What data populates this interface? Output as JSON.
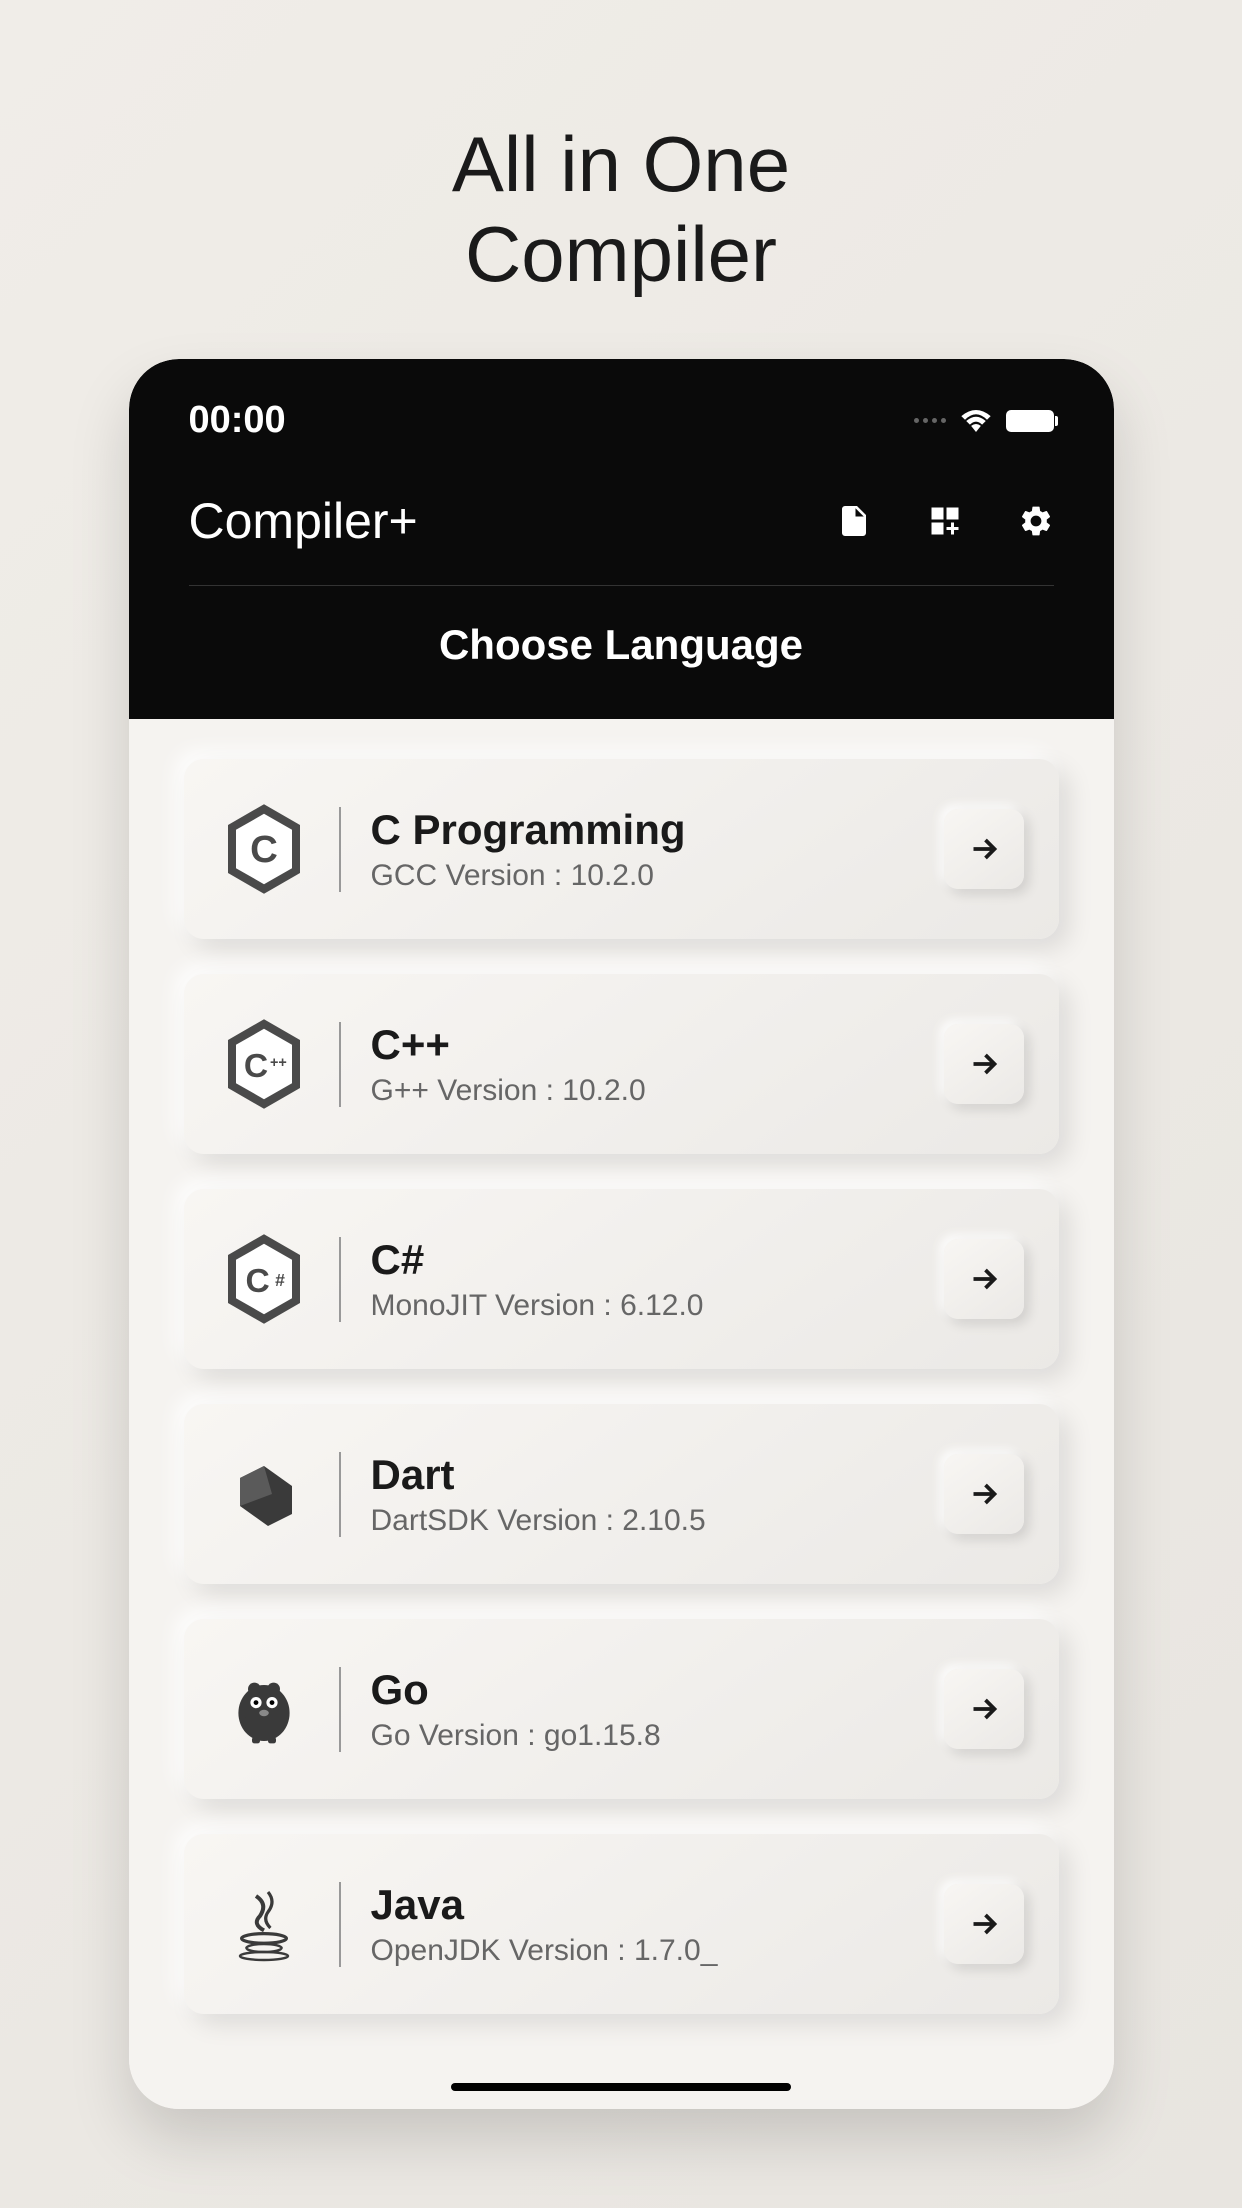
{
  "page": {
    "title_line1": "All in One",
    "title_line2": "Compiler"
  },
  "statusBar": {
    "time": "00:00"
  },
  "appBar": {
    "title": "Compiler+",
    "sectionTitle": "Choose Language"
  },
  "languages": [
    {
      "name": "C Programming",
      "version": "GCC Version : 10.2.0",
      "icon": "c-icon"
    },
    {
      "name": "C++",
      "version": "G++ Version : 10.2.0",
      "icon": "cpp-icon"
    },
    {
      "name": "C#",
      "version": "MonoJIT Version : 6.12.0",
      "icon": "csharp-icon"
    },
    {
      "name": "Dart",
      "version": "DartSDK Version : 2.10.5",
      "icon": "dart-icon"
    },
    {
      "name": "Go",
      "version": "Go Version : go1.15.8",
      "icon": "go-icon"
    },
    {
      "name": "Java",
      "version": "OpenJDK Version : 1.7.0_",
      "icon": "java-icon"
    }
  ]
}
